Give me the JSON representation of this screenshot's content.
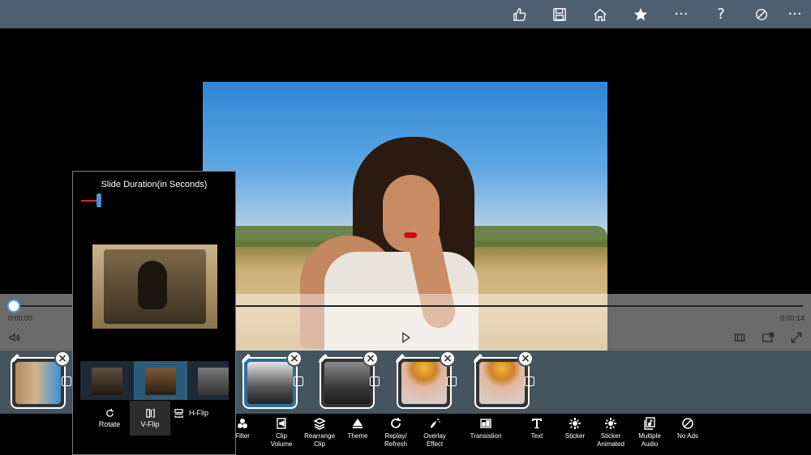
{
  "topbar": {
    "icons": [
      "thumbs-up-icon",
      "save-icon",
      "home-icon",
      "star-icon",
      "more-icon",
      "help-icon",
      "no-ads-icon",
      "more-icon"
    ],
    "more_label": "···",
    "help_label": "?",
    "overflow_label": "···"
  },
  "player": {
    "time_start": "0:00:00",
    "time_end": "0:00:14",
    "progress": 0.0
  },
  "popup": {
    "title": "Slide Duration(in Seconds)",
    "slider_value_fraction": 0.12,
    "buttons": [
      {
        "label": "Rotate",
        "icon": "rotate-icon"
      },
      {
        "label": "V-Flip",
        "icon": "v-flip-icon"
      },
      {
        "label": "H-Flip",
        "icon": "h-flip-icon"
      }
    ],
    "selected_button": "V-Flip"
  },
  "timeline": {
    "clips": [
      "clip-1",
      "clip-2",
      "clip-3",
      "clip-4",
      "clip-5",
      "clip-6"
    ],
    "remove_label": "×"
  },
  "toolbar": {
    "items": [
      {
        "label": "Filter",
        "icon": "filter-icon"
      },
      {
        "label": "Clip\nVolume",
        "icon": "clip-volume-icon"
      },
      {
        "label": "Rearrange\nClip",
        "icon": "rearrange-icon"
      },
      {
        "label": "Theme",
        "icon": "theme-icon"
      },
      {
        "label": "Replay/\nRefresh",
        "icon": "refresh-icon"
      },
      {
        "label": "Overlay\nEffect",
        "icon": "overlay-effect-icon"
      },
      {
        "label": "Transistion",
        "icon": "transition-icon"
      },
      {
        "label": "Text",
        "icon": "text-icon"
      },
      {
        "label": "Sticker",
        "icon": "sticker-icon"
      },
      {
        "label": "Sticker\nAnimated",
        "icon": "sticker-animated-icon"
      },
      {
        "label": "Multiple\nAudio",
        "icon": "multiple-audio-icon"
      },
      {
        "label": "No Ads",
        "icon": "no-ads-icon"
      }
    ]
  },
  "colors": {
    "topbar": "#4e6070",
    "timeline": "#44555f",
    "accent": "#4b8fd6",
    "slider_fill": "#d9262d"
  }
}
